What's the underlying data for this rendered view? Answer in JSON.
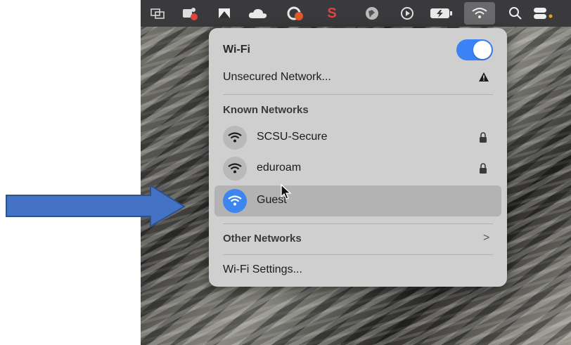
{
  "menubar": {
    "icons": [
      "screen-mirror-icon",
      "teams-icon",
      "image-capture-icon",
      "cloud-icon",
      "creative-cloud-icon",
      "s-app-icon",
      "globe-icon",
      "play-icon",
      "battery-icon",
      "wifi-icon",
      "search-icon",
      "control-center-icon"
    ],
    "s_app_label": "S"
  },
  "wifi_menu": {
    "title": "Wi-Fi",
    "toggle_on": true,
    "unsecured_label": "Unsecured Network...",
    "known_header": "Known Networks",
    "known_networks": [
      {
        "name": "SCSU-Secure",
        "locked": true
      },
      {
        "name": "eduroam",
        "locked": true
      },
      {
        "name": "Guest",
        "locked": false,
        "connected": true
      }
    ],
    "other_networks_label": "Other Networks",
    "other_networks_chevron": ">",
    "settings_label": "Wi-Fi Settings..."
  },
  "colors": {
    "accent": "#3b82f6",
    "arrow_fill": "#4472c4",
    "arrow_stroke": "#2f528f"
  }
}
